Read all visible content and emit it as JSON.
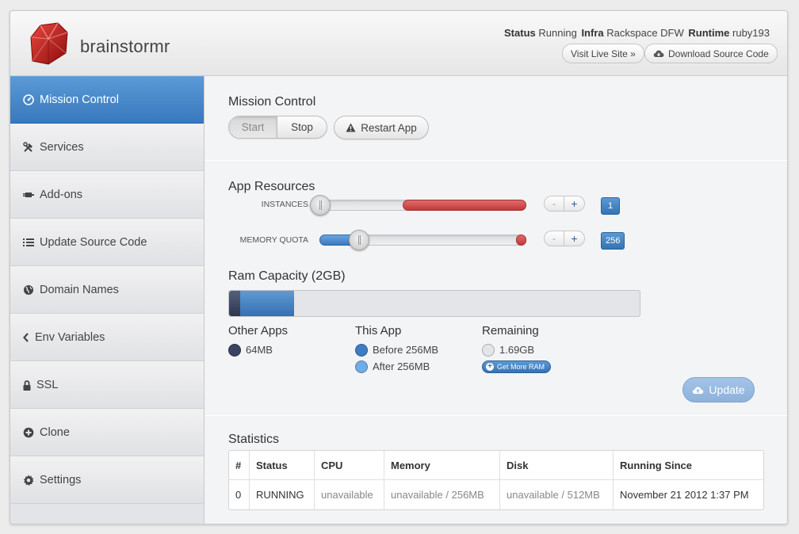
{
  "app": {
    "name": "brainstormr"
  },
  "header": {
    "status_label": "Status",
    "status_value": "Running",
    "infra_label": "Infra",
    "infra_value": "Rackspace DFW",
    "runtime_label": "Runtime",
    "runtime_value": "ruby193",
    "visit_label": "Visit Live Site »",
    "download_label": "Download Source Code"
  },
  "sidebar": {
    "items": [
      {
        "label": "Mission Control",
        "icon": "dashboard-icon",
        "active": true
      },
      {
        "label": "Services",
        "icon": "tools-icon"
      },
      {
        "label": "Add-ons",
        "icon": "plug-icon"
      },
      {
        "label": "Update Source Code",
        "icon": "list-icon"
      },
      {
        "label": "Domain Names",
        "icon": "globe-icon"
      },
      {
        "label": "Env Variables",
        "icon": "chevron-left-icon"
      },
      {
        "label": "SSL",
        "icon": "lock-icon"
      },
      {
        "label": "Clone",
        "icon": "plus-circle-icon"
      },
      {
        "label": "Settings",
        "icon": "gear-icon"
      }
    ]
  },
  "mission": {
    "title": "Mission Control",
    "start_label": "Start",
    "stop_label": "Stop",
    "restart_label": "Restart App"
  },
  "resources": {
    "title": "App Resources",
    "instances": {
      "label": "INSTANCES",
      "value": "1",
      "minus": "-",
      "plus": "+"
    },
    "memory": {
      "label": "MEMORY QUOTA",
      "value": "256",
      "minus": "-",
      "plus": "+"
    }
  },
  "ram": {
    "title": "Ram Capacity (2GB)",
    "other_head": "Other Apps",
    "other_value": "64MB",
    "this_head": "This App",
    "before_value": "Before 256MB",
    "after_value": "After 256MB",
    "remaining_head": "Remaining",
    "remaining_value": "1.69GB",
    "get_more_label": "Get More RAM",
    "update_label": "Update"
  },
  "statistics": {
    "title": "Statistics",
    "columns": [
      "#",
      "Status",
      "CPU",
      "Memory",
      "Disk",
      "Running Since"
    ],
    "rows": [
      [
        "0",
        "RUNNING",
        "unavailable",
        "unavailable / 256MB",
        "unavailable / 512MB",
        "November 21 2012 1:37 PM"
      ]
    ]
  },
  "colors": {
    "accent": "#3878bd",
    "danger": "#c23a3a",
    "other_apps": "#2d3650",
    "update_button": "#9bbde3"
  }
}
